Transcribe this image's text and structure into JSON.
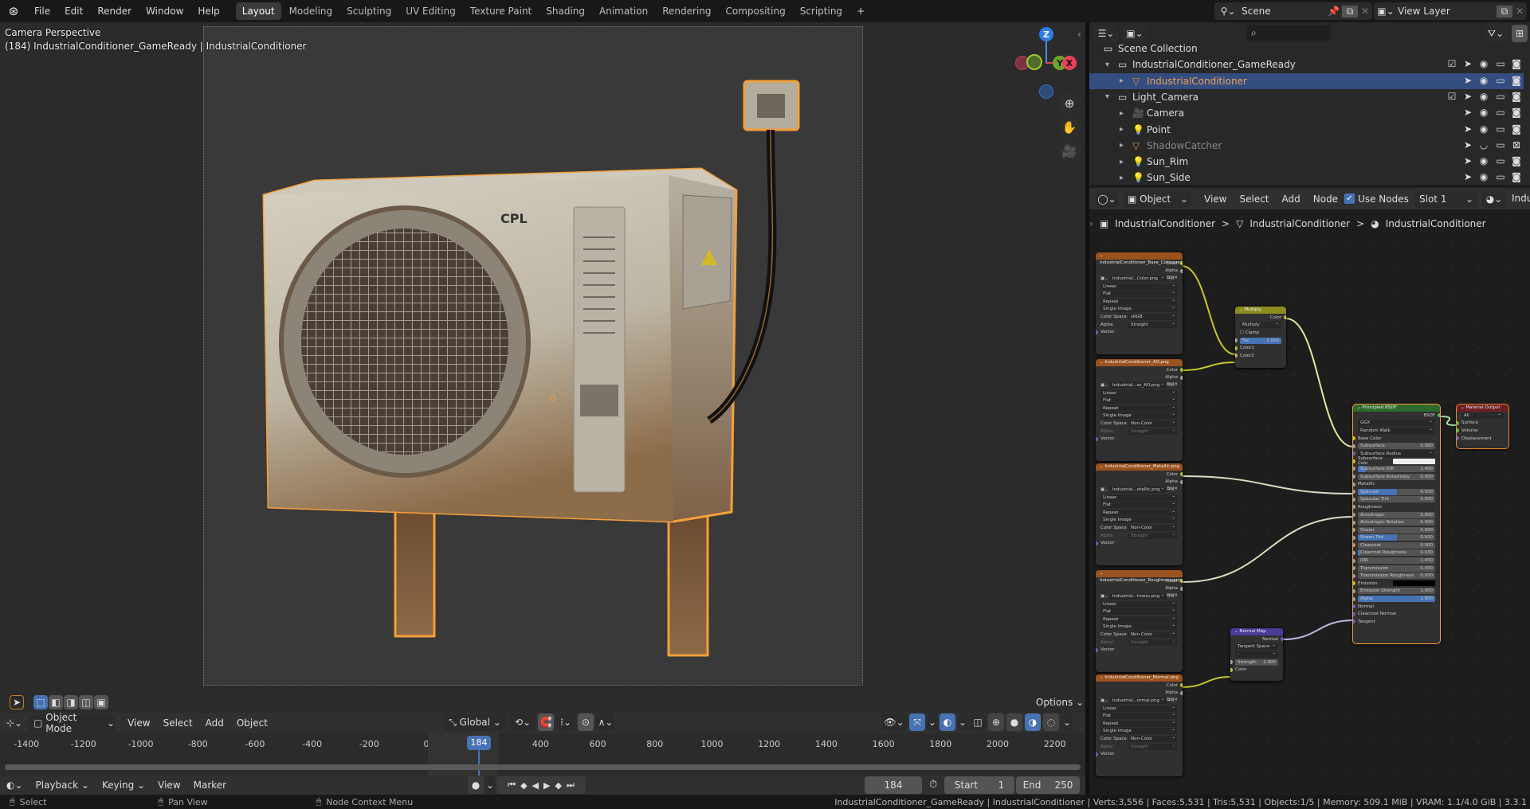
{
  "topbar": {
    "menus": [
      "File",
      "Edit",
      "Render",
      "Window",
      "Help"
    ],
    "workspaces": [
      "Layout",
      "Modeling",
      "Sculpting",
      "UV Editing",
      "Texture Paint",
      "Shading",
      "Animation",
      "Rendering",
      "Compositing",
      "Scripting"
    ],
    "active_workspace": "Layout",
    "add_tab": "+",
    "scene": "Scene",
    "view_layer": "View Layer"
  },
  "viewport": {
    "view_name": "Camera Perspective",
    "object_info": "(184) IndustrialConditioner_GameReady | IndustrialConditioner",
    "model_label": "CPL",
    "options": "Options",
    "gizmo": {
      "x": "X",
      "y": "Y",
      "z": "Z"
    },
    "header": {
      "mode": "Object Mode",
      "menus": [
        "View",
        "Select",
        "Add",
        "Object"
      ],
      "orientation": "Global"
    }
  },
  "timeline": {
    "ticks": [
      -1400,
      -1200,
      -1000,
      -800,
      -600,
      -400,
      -200,
      0,
      200,
      400,
      600,
      800,
      1000,
      1200,
      1400,
      1600,
      1800,
      2000,
      2200
    ],
    "current_frame": 184,
    "current_frame_label": "184",
    "menus": [
      "Playback",
      "Keying",
      "View",
      "Marker"
    ],
    "frame_field": "184",
    "start_label": "Start",
    "start": "1",
    "end_label": "End",
    "end": "250"
  },
  "statusbar": {
    "select": "Select",
    "pan": "Pan View",
    "context": "Node Context Menu",
    "info": "IndustrialConditioner_GameReady | IndustrialConditioner | Verts:3,556 | Faces:5,531 | Tris:5,531 | Objects:1/5 | Memory: 509.1 MiB | VRAM: 1.1/4.0 GiB | 3.3.1"
  },
  "outliner": {
    "search_placeholder": "",
    "rows": [
      {
        "label": "Scene Collection",
        "level": 0,
        "type": "collection"
      },
      {
        "label": "IndustrialConditioner_GameReady",
        "level": 1,
        "type": "collection",
        "checkbox": true,
        "expanded": true
      },
      {
        "label": "IndustrialConditioner",
        "level": 2,
        "type": "mesh",
        "selected": true
      },
      {
        "label": "Light_Camera",
        "level": 1,
        "type": "collection",
        "checkbox": true,
        "expanded": true
      },
      {
        "label": "Camera",
        "level": 2,
        "type": "camera"
      },
      {
        "label": "Point",
        "level": 2,
        "type": "light"
      },
      {
        "label": "ShadowCatcher",
        "level": 2,
        "type": "mesh",
        "disabled": true
      },
      {
        "label": "Sun_Rim",
        "level": 2,
        "type": "light"
      },
      {
        "label": "Sun_Side",
        "level": 2,
        "type": "light"
      }
    ]
  },
  "node_editor": {
    "object_type": "Object",
    "menus": [
      "View",
      "Select",
      "Add",
      "Node"
    ],
    "use_nodes": "Use Nodes",
    "slot": "Slot 1",
    "material_cut": "Indu",
    "breadcrumb": [
      "IndustrialConditioner",
      "IndustrialConditioner",
      "IndustrialConditioner"
    ],
    "image_nodes": [
      {
        "title": "IndustrialConditioner_Base_Color.png",
        "image": "Industrial...Color.png",
        "color_space": "sRGB"
      },
      {
        "title": "IndustrialConditioner_AO.png",
        "image": "Industrial...er_AO.png",
        "color_space": "Non-Color"
      },
      {
        "title": "IndustrialConditioner_Metallic.png",
        "image": "Industrial...etallic.png",
        "color_space": "Non-Color"
      },
      {
        "title": "IndustrialConditioner_Roughness.png",
        "image": "Industrial...hness.png",
        "color_space": "Non-Color"
      },
      {
        "title": "IndustrialConditioner_Normal.png",
        "image": "Industrial...ormal.png",
        "color_space": "Non-Color"
      }
    ],
    "image_common": {
      "outputs": [
        "Color",
        "Alpha"
      ],
      "interpolation": "Linear",
      "projection": "Flat",
      "extension": "Repeat",
      "source": "Single Image",
      "color_space_label": "Color Space",
      "alpha_label": "Alpha",
      "alpha": "Straight",
      "vector": "Vector"
    },
    "multiply": {
      "title": "Multiply",
      "output": "Color",
      "mode": "Multiply",
      "clamp": "Clamp",
      "fac_label": "Fac",
      "fac": "1.000",
      "inputs": [
        "Color1",
        "Color2"
      ]
    },
    "normal_map": {
      "title": "Normal Map",
      "output": "Normal",
      "space": "Tangent Space",
      "uv": "-",
      "strength_label": "Strength",
      "strength": "1.000",
      "input": "Color"
    },
    "output": {
      "title": "Material Output",
      "target": "All",
      "inputs": [
        "Surface",
        "Volume",
        "Displacement"
      ]
    },
    "principled": {
      "title": "Principled BSDF",
      "output": "BSDF",
      "distribution": "GGX",
      "subsurface_method": "Random Walk",
      "rows": [
        {
          "kind": "socket",
          "label": "Base Color",
          "sock": "#c7c729"
        },
        {
          "kind": "field",
          "label": "Subsurface",
          "value": "0.000",
          "fill": 0
        },
        {
          "kind": "dd",
          "label": "Subsurface Radius",
          "sock": "#6363c7"
        },
        {
          "kind": "color",
          "label": "Subsurface Colo",
          "swatch": "#eeeeee",
          "sock": "#c7c729"
        },
        {
          "kind": "field",
          "label": "Subsurface IOR",
          "value": "1.400",
          "fill": 0.1
        },
        {
          "kind": "field",
          "label": "Subsurface Anisotropy",
          "value": "0.000",
          "fill": 0
        },
        {
          "kind": "socket",
          "label": "Metallic"
        },
        {
          "kind": "field",
          "label": "Specular",
          "value": "0.500",
          "fill": 0.5
        },
        {
          "kind": "field",
          "label": "Specular Tint",
          "value": "0.000",
          "fill": 0
        },
        {
          "kind": "socket",
          "label": "Roughness"
        },
        {
          "kind": "field",
          "label": "Anisotropic",
          "value": "0.000",
          "fill": 0
        },
        {
          "kind": "field",
          "label": "Anisotropic Rotation",
          "value": "0.000",
          "fill": 0
        },
        {
          "kind": "field",
          "label": "Sheen",
          "value": "0.000",
          "fill": 0
        },
        {
          "kind": "field",
          "label": "Sheen Tint",
          "value": "0.500",
          "fill": 0.5
        },
        {
          "kind": "field",
          "label": "Clearcoat",
          "value": "0.000",
          "fill": 0
        },
        {
          "kind": "field",
          "label": "Clearcoat Roughness",
          "value": "0.030",
          "fill": 0.03
        },
        {
          "kind": "field",
          "label": "IOR",
          "value": "1.450",
          "fill": 0
        },
        {
          "kind": "field",
          "label": "Transmission",
          "value": "0.000",
          "fill": 0
        },
        {
          "kind": "field",
          "label": "Transmission Roughness",
          "value": "0.000",
          "fill": 0
        },
        {
          "kind": "color",
          "label": "Emission",
          "swatch": "#000000",
          "sock": "#c7c729"
        },
        {
          "kind": "field",
          "label": "Emission Strength",
          "value": "1.000",
          "fill": 0
        },
        {
          "kind": "field",
          "label": "Alpha",
          "value": "1.000",
          "fill": 1
        },
        {
          "kind": "socket",
          "label": "Normal",
          "sock": "#6363c7"
        },
        {
          "kind": "socket",
          "label": "Clearcoat Normal",
          "sock": "#6363c7"
        },
        {
          "kind": "socket",
          "label": "Tangent",
          "sock": "#6363c7"
        }
      ]
    }
  },
  "colors": {
    "accent": "#4772b3",
    "selection_outline": "#f5a03a",
    "image_node_header": "#9a521e",
    "multiply_header": "#8c8c1e",
    "principled_header": "#2d6b2d",
    "output_header": "#6b1f24",
    "normal_header": "#4a3c9a",
    "link_color": "#c7c729",
    "link_gray": "#c9c9c9"
  }
}
